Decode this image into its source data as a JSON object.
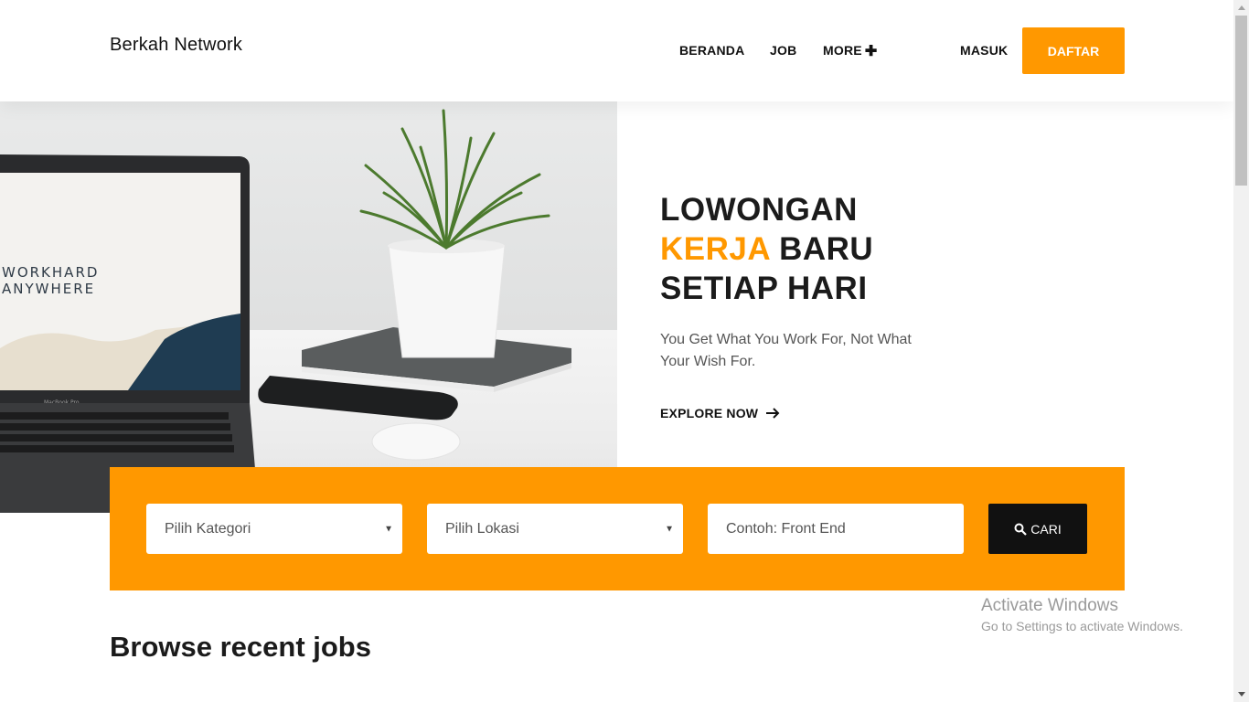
{
  "header": {
    "brand": "Berkah Network",
    "nav": {
      "beranda": "BERANDA",
      "job": "JOB",
      "more": "MORE",
      "more_icon": "plus-icon",
      "masuk": "MASUK",
      "daftar": "DAFTAR"
    }
  },
  "hero": {
    "image_alt": "laptop-and-plant-desk-photo",
    "laptop_screen_line1": "WORKHARD",
    "laptop_screen_line2": "ANYWHERE",
    "laptop_brand": "MacBook Pro",
    "title_line1": "LOWONGAN",
    "title_accent": "KERJA",
    "title_line2_rest": " BARU",
    "title_line3": "SETIAP HARI",
    "subtitle": "You Get What You Work For, Not What Your Wish For.",
    "cta": "EXPLORE NOW"
  },
  "search": {
    "category_placeholder": "Pilih Kategori",
    "location_placeholder": "Pilih Lokasi",
    "keyword_placeholder": "Contoh: Front End",
    "button_label": "CARI"
  },
  "browse": {
    "title": "Browse recent jobs"
  },
  "watermark": {
    "line1": "Activate Windows",
    "line2": "Go to Settings to activate Windows."
  },
  "colors": {
    "accent": "#ff9800",
    "dark": "#111111"
  }
}
